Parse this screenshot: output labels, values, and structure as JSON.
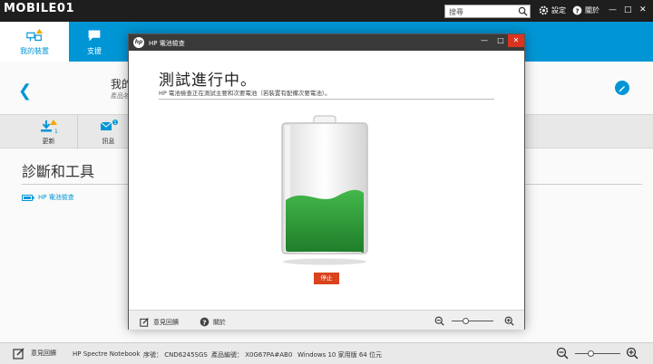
{
  "watermark": "MOBILE01",
  "topbar": {
    "search_placeholder": "搜尋",
    "settings_label": "設定",
    "help_label": "關於",
    "minimize": "—",
    "maximize": "□",
    "close": "✕"
  },
  "nav": {
    "tabs": [
      {
        "label": "我的裝置",
        "icon": "devices-icon"
      },
      {
        "label": "支援",
        "icon": "chat-icon"
      }
    ]
  },
  "device": {
    "title": "我的",
    "subtitle": "產品名"
  },
  "strip": {
    "items": [
      {
        "label": "更新",
        "badge": "1"
      },
      {
        "label": "訊息",
        "badge": "1"
      }
    ]
  },
  "diagnostics": {
    "title": "診斷和工具",
    "link": "HP 電池檢查"
  },
  "dialog": {
    "title": "HP 電池檢查",
    "logo": "hp",
    "heading": "測試進行中。",
    "description": "HP 電池檢查正在測試主要和次要電池（若裝置有配備次要電池）。",
    "stop_label": "停止",
    "battery_level": 0.45,
    "battery_color": "#2ea043",
    "footer": {
      "feedback": "意見回饋",
      "about": "關於"
    }
  },
  "statusbar": {
    "feedback": "意見回饋",
    "product": "HP Spectre Notebook",
    "serial": "序號： CND6245SGS",
    "product_no": "產品編號： X0G67PA#AB0",
    "os": "Windows 10 家用版 64 位元"
  },
  "colors": {
    "accent": "#0096d6",
    "close": "#d9341f",
    "stop": "#d9431e"
  }
}
